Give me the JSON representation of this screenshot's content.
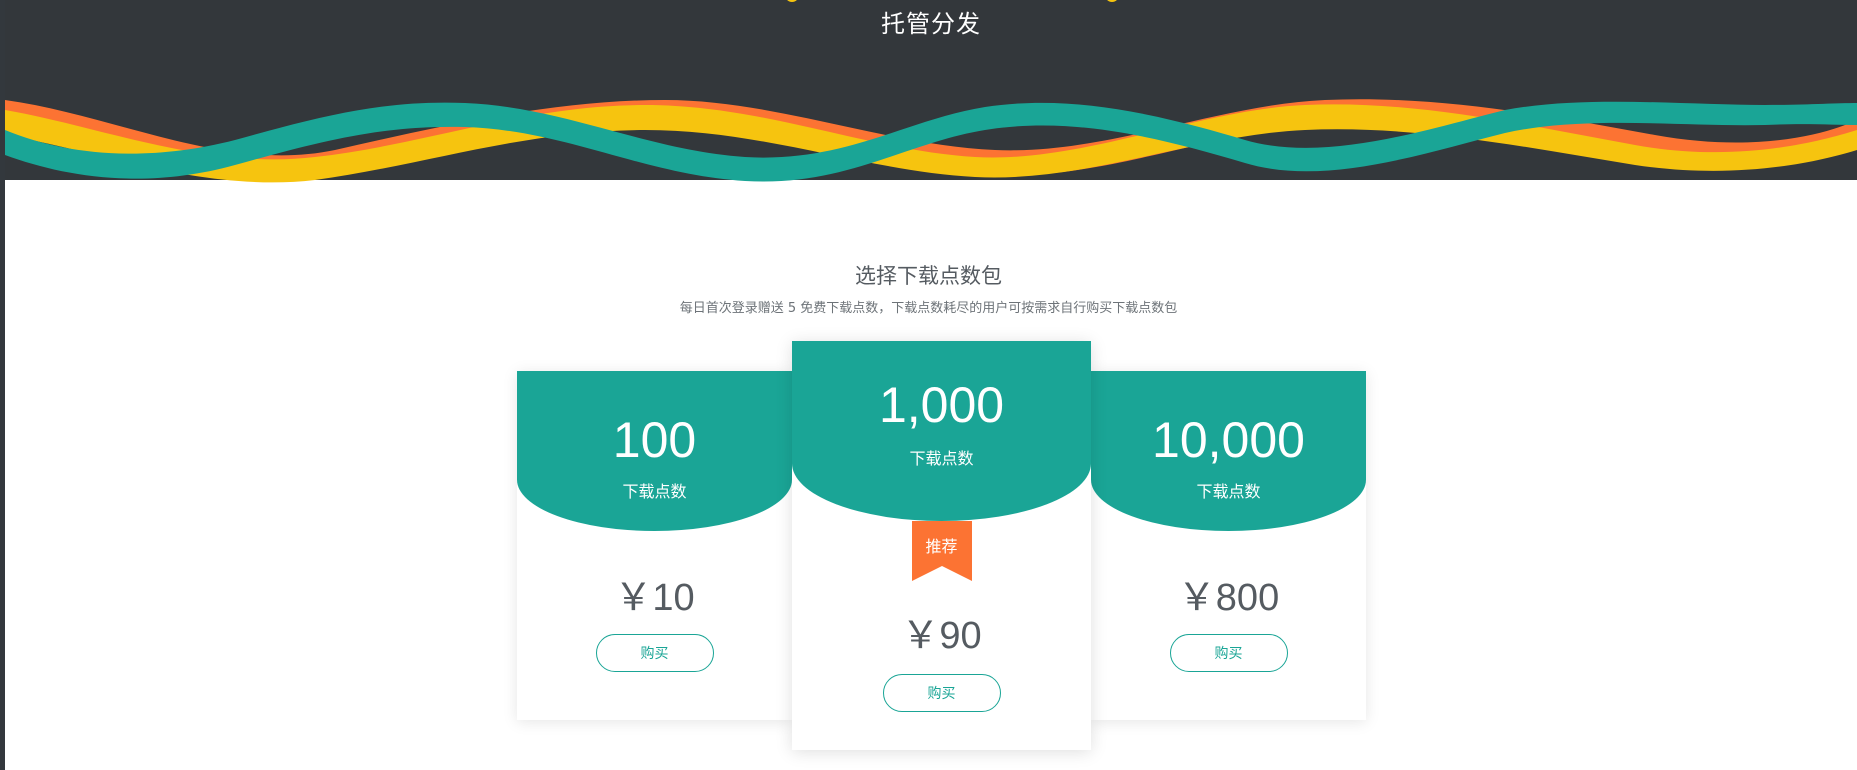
{
  "header": {
    "title": "托管分发"
  },
  "packages": {
    "title": "选择下载点数包",
    "subtitle": "每日首次登录赠送 5 免费下载点数，下载点数耗尽的用户可按需求自行购买下载点数包",
    "items": [
      {
        "points": "100",
        "unit": "下载点数",
        "price": "￥10",
        "button": "购买"
      },
      {
        "points": "1,000",
        "unit": "下载点数",
        "badge": "推荐",
        "price": "￥90",
        "button": "购买"
      },
      {
        "points": "10,000",
        "unit": "下载点数",
        "price": "￥800",
        "button": "购买"
      }
    ]
  },
  "colors": {
    "header_bg": "#33373b",
    "teal": "#1aa596",
    "orange": "#fc7333",
    "yellow": "#f6c40f",
    "text_gray": "#555b61"
  }
}
